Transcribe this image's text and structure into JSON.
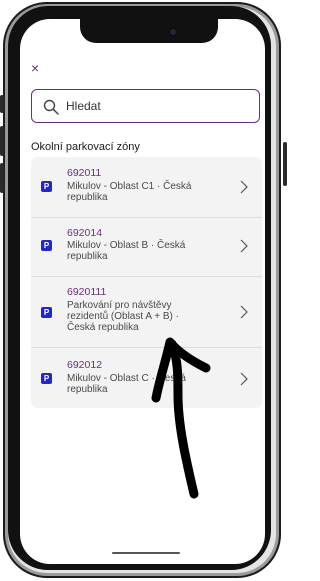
{
  "close_icon": "×",
  "search": {
    "placeholder": "Hledat"
  },
  "section_title": "Okolní parkovací zóny",
  "badge_label": "P",
  "zones": [
    {
      "id": "692011",
      "name": "Mikulov - Oblast C1 · Česká republika"
    },
    {
      "id": "692014",
      "name": "Mikulov - Oblast B · Česká republika"
    },
    {
      "id": "6920111",
      "name": "Parkování pro návštěvy rezidentů (Oblast A + B) · Česká republika"
    },
    {
      "id": "692012",
      "name": "Mikulov - Oblast C · Česká republika"
    }
  ],
  "colors": {
    "accent": "#6b2f7d",
    "badge": "#2029c8",
    "list_bg": "#f3f3f3"
  }
}
